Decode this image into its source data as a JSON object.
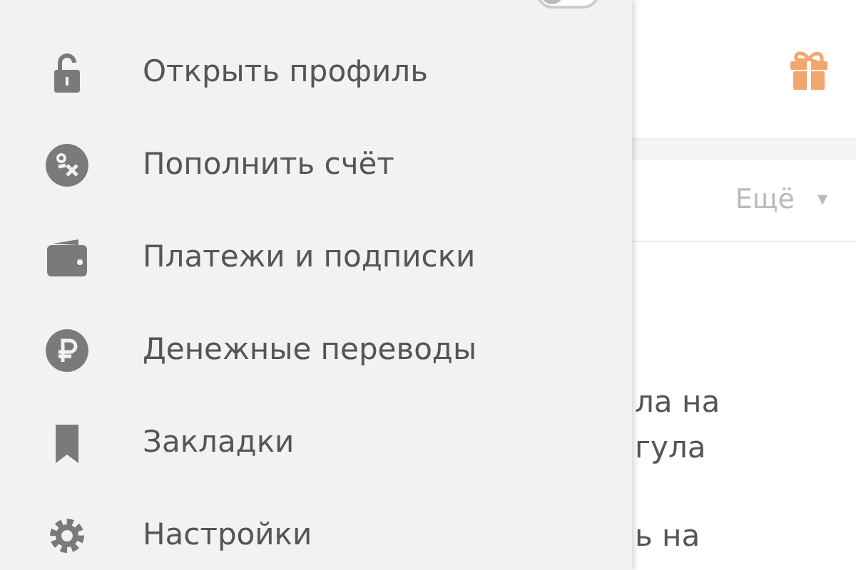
{
  "drawer": {
    "toggle": {
      "on": false
    },
    "items": [
      {
        "kind": "lock",
        "label": "Открыть профиль"
      },
      {
        "kind": "coin",
        "label": "Пополнить счёт"
      },
      {
        "kind": "wallet",
        "label": "Платежи и подписки"
      },
      {
        "kind": "ruble",
        "label": "Денежные переводы"
      },
      {
        "kind": "bookmark",
        "label": "Закладки"
      },
      {
        "kind": "gear",
        "label": "Настройки"
      }
    ]
  },
  "main": {
    "more_menu": {
      "label": "Ещё",
      "caret": "▾"
    },
    "text_lines": [
      "ла на",
      "гула",
      "ь на"
    ]
  }
}
